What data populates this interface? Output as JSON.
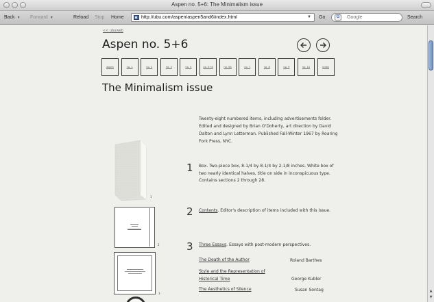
{
  "window": {
    "title": "Aspen no. 5+6: The Minimalism issue"
  },
  "toolbar": {
    "back": "Back",
    "forward": "Forward",
    "reload": "Reload",
    "stop": "Stop",
    "home": "Home",
    "url": "http://ubu.com/aspen/aspen5and6/index.html",
    "go": "Go",
    "search_placeholder": "Google",
    "search_label": "Search"
  },
  "page": {
    "up_link": "<< ubuweb",
    "heading": "Aspen no. 5+6",
    "prev_icon": "left-arrow-circle-icon",
    "next_icon": "right-arrow-circle-icon",
    "nav_boxes": [
      "aspen",
      "no. 1",
      "no. 2",
      "no. 3",
      "no. 4",
      "no. 5+6",
      "no. 5A",
      "no. 7",
      "no. 8",
      "no. 9",
      "no. 10",
      "index"
    ],
    "issue_title": "The Minimalism issue",
    "description": "Twenty-eight numbered items, including advertisements folder. Edited and designed by Brian O'Doherty, art direction by David Dalton and Lynn Letterman. Published Fall-Winter 1967 by Roaring Fork Press, NYC.",
    "items": [
      {
        "num": "1",
        "label": "Box.",
        "text": " Two-piece box, 8-1/4 by 8-1/4 by 2-1/8 inches. White box of two nearly identical halves, title on side in inconspicuous type. Contains sections 2 through 28."
      },
      {
        "num": "2",
        "label": "Contents",
        "text": ". Editor's description of items included with this issue."
      },
      {
        "num": "3",
        "label": "Three Essays",
        "text": ". Essays with post-modern perspectives."
      }
    ],
    "essays": [
      {
        "title": "The Death of the Author",
        "author": "Roland Barthes"
      },
      {
        "title": "Style and the Representation of Historical Time",
        "author": "George Kubler"
      },
      {
        "title": "The Aesthetics of Silence",
        "author": "Susan Sontag"
      }
    ],
    "thumb_indices": [
      "1",
      "2",
      "3"
    ]
  }
}
